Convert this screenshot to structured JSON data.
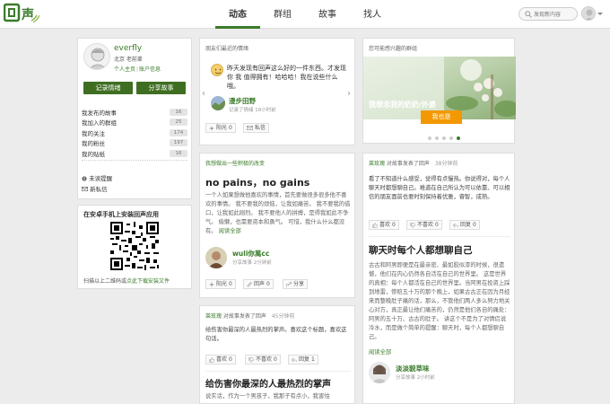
{
  "header": {
    "logo_text": "回声",
    "nav": [
      {
        "label": "动态",
        "active": true
      },
      {
        "label": "群组",
        "active": false
      },
      {
        "label": "故事",
        "active": false
      },
      {
        "label": "找人",
        "active": false
      }
    ],
    "search_placeholder": "发现新内容"
  },
  "profile": {
    "name": "everfly",
    "location": "北京 老前辈",
    "home_link": "个人主页",
    "settings_link": "账户信息",
    "record_button": "记录情绪",
    "share_button": "分享故事",
    "stats": [
      {
        "label": "我发布的故事",
        "count": "16"
      },
      {
        "label": "我加入的群组",
        "count": "25"
      },
      {
        "label": "我的关注",
        "count": "174"
      },
      {
        "label": "我的粉丝",
        "count": "197"
      },
      {
        "label": "我的贴纸",
        "count": "16"
      }
    ],
    "unread_notice": "未读提醒",
    "new_message": "新私信"
  },
  "app_download": {
    "title": "在安卓手机上安装回声应用",
    "caption_prefix": "扫描以上二维码或",
    "caption_link": "点此下载安装文件"
  },
  "friends_mood": {
    "title": "朋友们最近的情绪",
    "text": "昨天发现有回声这么好的一件东西。才发现你 我 值得拥有！哈哈哈！我在说些什么哦。",
    "author": "漫步田野",
    "meta": "记录了情绪   18小时前",
    "sun_label": "阳光",
    "sun_count": "0",
    "msg_label": "私信"
  },
  "change_post": {
    "section_title": "我想做出一些积极的改变",
    "title": "no pains，no gains",
    "body": "一个人如果想做他喜欢的事情，首先要做很多很多他不喜欢的事情。 我不要我的烦恼，让我如痛苦。 我不要我的借口，让我如此刚烈。 我不要他人的拼搏，是得我如此不争气。 偷懒，也需要资本和勇气。 可惜，我什么什么都没有。",
    "read_more": "阅读全部",
    "author": "wuli你萬cc",
    "meta": "分享故事   2分钟前",
    "sun_label": "阳光",
    "sun_count": "0",
    "echo_label": "回声",
    "echo_count": "0",
    "share_label": "分享"
  },
  "story_post": {
    "head_user": "莱玫瑰",
    "head_text": " 对故事发表了回声",
    "head_time": "45分钟前",
    "comment": "给伤害你最深的人最热烈的掌声。喜欢这个标题，喜欢这句话。",
    "like_label": "喜欢",
    "like_count": "0",
    "dislike_label": "不喜欢",
    "dislike_count": "0",
    "reply_label": "回复",
    "reply_count": "1",
    "title": "给伤害你最深的人最热烈的掌声",
    "body": "说实话，作为一个男孩子，我那子有点小，我害怕"
  },
  "group_recommend": {
    "title": "您可能感兴趣的群组",
    "hero_text": "我想念我的奶奶/外婆",
    "join_button": "我也是"
  },
  "chat_post": {
    "head_user": "莱玫瑰",
    "head_text": " 对故事发表了回声",
    "head_time": "38分钟前",
    "comment": "看了不知道什么感受，觉得有点慢热。你说得对，每个人聊天时都想聊自己。难道在自己所认为可以依靠、可以相信的朋友面前也要时刻保持着优雅，睿智，成熟。",
    "like_label": "喜欢",
    "like_count": "0",
    "dislike_label": "不喜欢",
    "dislike_count": "0",
    "reply_label": "回复",
    "reply_count": "0",
    "title": "聊天时每个人都想聊自己",
    "body": "古古和阿男即便是在最亲密、最如胶似漆的时候，很遗憾，他们在内心仍然各自活在自己的世界里。 这是世界的真相：每个人都活在自己的世界里。当阿男在投资上踩到地雷，惨赔五十万的那个晚上，如果古古正在因为月经来而整晚肚子痛的话，那么，不管他们两人多么努力地关心对方，真正最让他们痛苦的，仍然是他们各自的痛处：阿男的五十万、古古的肚子。 讲这个不是为了对情侣说冷水，而是做个简单的提醒：聊天时，每个人都想聊自己。",
    "read_more": "阅读全部",
    "author": "淡淡貌草味",
    "meta": "分享故事   2小时前"
  }
}
